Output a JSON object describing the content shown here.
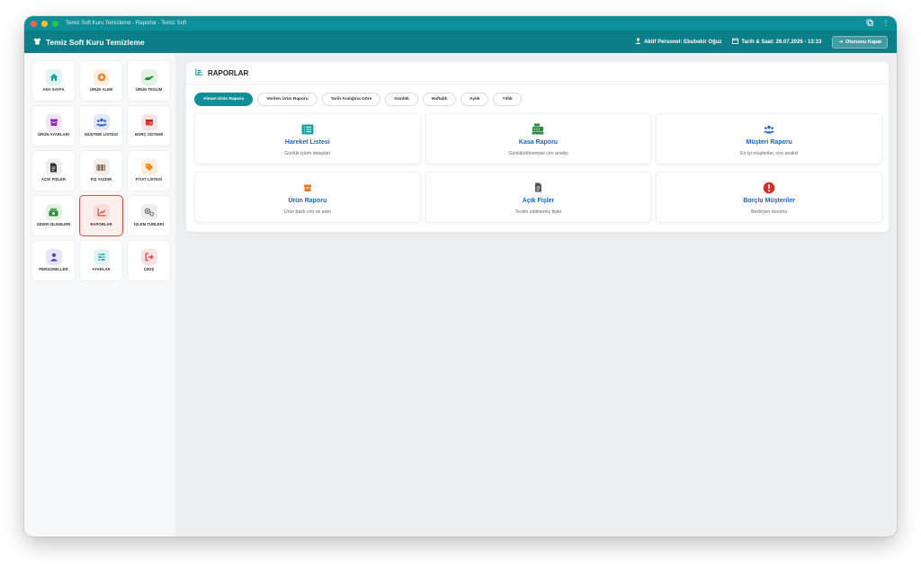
{
  "window": {
    "title": "Temiz Soft Kuru Temizleme - Raporlar - Temiz Soft"
  },
  "header": {
    "brand": "Temiz Soft Kuru Temizleme",
    "personnel": "Aktif Personel: Ebubekir Oğuz",
    "datetime": "Tarih & Saat: 26.07.2026 - 13:33",
    "logout": "Oturumu Kapat"
  },
  "sidebar": {
    "items": [
      {
        "label": "ANA SAYFA",
        "icon": "home-icon",
        "color": "#16a3a3",
        "bg": "#dff4f3"
      },
      {
        "label": "ÜRÜN ALIMI",
        "icon": "plus-circle-icon",
        "color": "#f07a22",
        "bg": "#fdeee0"
      },
      {
        "label": "ÜRÜN TESLİM",
        "icon": "hand-icon",
        "color": "#2e8b3d",
        "bg": "#e3f2e5"
      },
      {
        "label": "ÜRÜN AYARLARI",
        "icon": "box-icon",
        "color": "#8a2dbd",
        "bg": "#f1e3f8"
      },
      {
        "label": "MÜŞTERİ LİSTESİ",
        "icon": "users-icon",
        "color": "#2f63c9",
        "bg": "#e2eaf8"
      },
      {
        "label": "BORÇ SİSTEMİ",
        "icon": "wallet-icon",
        "color": "#e03a3a",
        "bg": "#fbe2e2"
      },
      {
        "label": "AÇIK FİŞLER",
        "icon": "file-icon",
        "color": "#333333",
        "bg": "#eceeef"
      },
      {
        "label": "FİŞ YAZDIR",
        "icon": "barcode-icon",
        "color": "#6b5b4b",
        "bg": "#f2ece6"
      },
      {
        "label": "FİYAT LİSTESİ",
        "icon": "tag-icon",
        "color": "#f08a1e",
        "bg": "#fdeedc"
      },
      {
        "label": "GİDER İŞLEMLERİ",
        "icon": "money-icon",
        "color": "#2e8b3d",
        "bg": "#e3f2e5"
      },
      {
        "label": "RAPORLAR",
        "icon": "chart-icon",
        "color": "#e03a3a",
        "bg": "#fbdcdc",
        "active": true
      },
      {
        "label": "İŞLEM TÜRLERİ",
        "icon": "gears-icon",
        "color": "#444444",
        "bg": "#eceeef"
      },
      {
        "label": "PERSONELLER",
        "icon": "user-icon",
        "color": "#5b3fbf",
        "bg": "#e9e4f8"
      },
      {
        "label": "AYARLAR",
        "icon": "sliders-icon",
        "color": "#16a3a3",
        "bg": "#dff4f3"
      },
      {
        "label": "ÇIKIŞ",
        "icon": "signout-icon",
        "color": "#e03a3a",
        "bg": "#fbe2e2"
      }
    ]
  },
  "main": {
    "title": "RAPORLAR",
    "tabs": [
      {
        "label": "Alınan Ürün Raporu",
        "active": true
      },
      {
        "label": "Verilen Ürün Raporu"
      },
      {
        "label": "Tarih Aralığına Göre"
      },
      {
        "label": "Günlük"
      },
      {
        "label": "Haftalık"
      },
      {
        "label": "Aylık"
      },
      {
        "label": "Yıllık"
      }
    ],
    "cards": [
      {
        "title": "Hareket Listesi",
        "subtitle": "Günlük işlem detayları",
        "icon": "list-icon",
        "color": "#16a3a3"
      },
      {
        "title": "Kasa Raporu",
        "subtitle": "Günlük/dönemsel ciro analizi",
        "icon": "cash-register-icon",
        "color": "#2e8b3d"
      },
      {
        "title": "Müşteri Raporu",
        "subtitle": "En iyi müşteriler, ciro analizi",
        "icon": "users-icon",
        "color": "#2f63c9"
      },
      {
        "title": "Ürün Raporu",
        "subtitle": "Ürün bazlı ciro ve adet",
        "icon": "box-icon",
        "color": "#e07b24"
      },
      {
        "title": "Açık Fişler",
        "subtitle": "Teslim edilmemiş fişler",
        "icon": "file-icon",
        "color": "#555555"
      },
      {
        "title": "Borçlu Müşteriler",
        "subtitle": "Bekleyen durumu",
        "icon": "exclamation-icon",
        "color": "#d32f2f"
      }
    ]
  }
}
